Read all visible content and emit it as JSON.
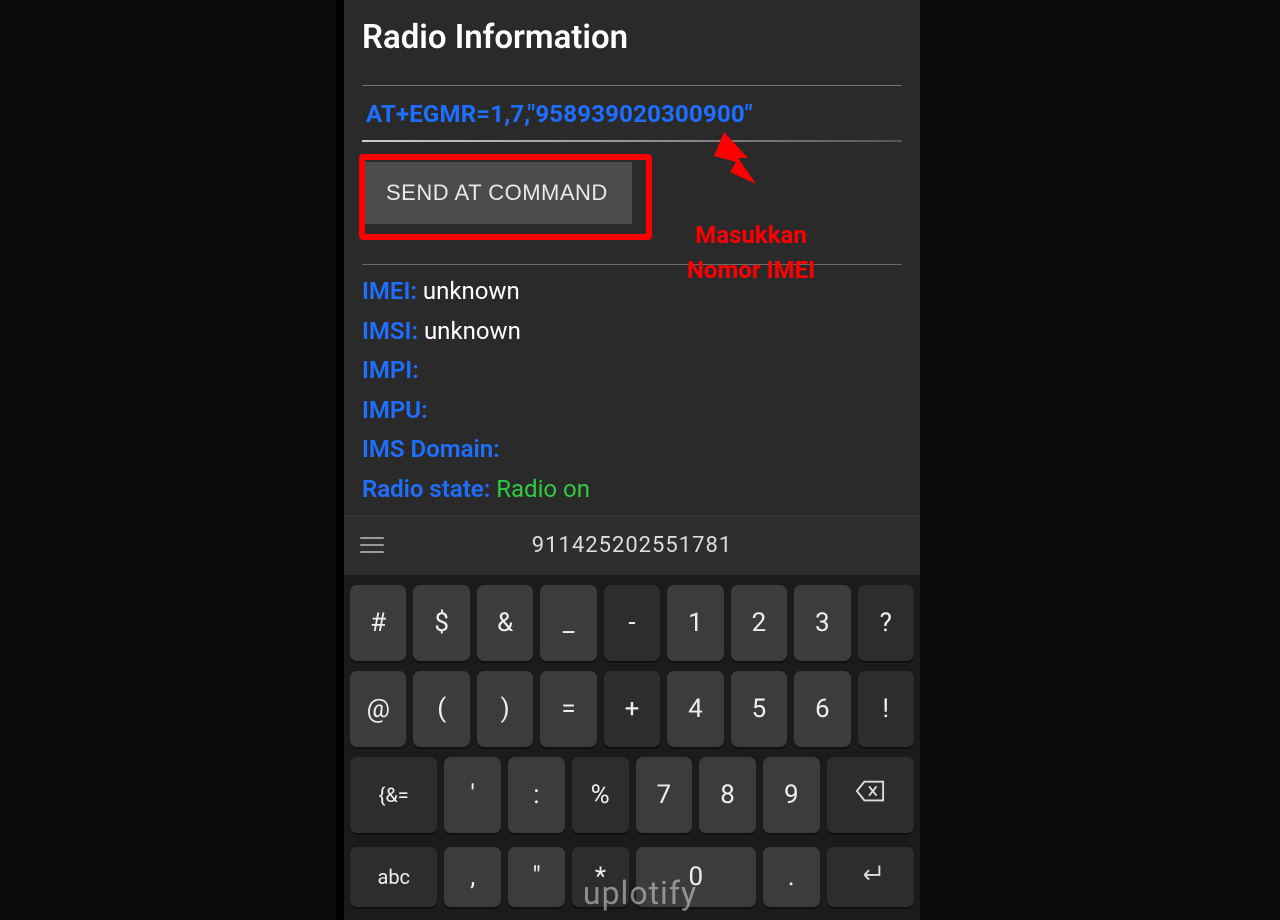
{
  "title": "Radio Information",
  "cmd_input": "AT+EGMR=1,7,\"958939020300900\"",
  "send_button": "SEND AT COMMAND",
  "hint": {
    "line1": "Masukkan",
    "line2": "Nomor IMEI"
  },
  "info": {
    "imei_label": "IMEI:",
    "imei_value": "unknown",
    "imsi_label": "IMSI:",
    "imsi_value": "unknown",
    "impi_label": "IMPI:",
    "impi_value": "",
    "impu_label": "IMPU:",
    "impu_value": "",
    "ims_label": "IMS Domain:",
    "ims_value": "",
    "radio_label": "Radio state:",
    "radio_value": "Radio on"
  },
  "keyboard_bar": "911425202551781",
  "keys": {
    "r1": [
      "#",
      "$",
      "&",
      "_",
      "-",
      "1",
      "2",
      "3",
      "?"
    ],
    "r2": [
      "@",
      "(",
      ")",
      "=",
      "+",
      "4",
      "5",
      "6",
      "!"
    ],
    "r3_left": "{&=",
    "r3_mid": [
      "'",
      ":",
      "%"
    ],
    "r3_num": [
      "7",
      "8",
      "9"
    ],
    "r4_left": "abc",
    "r4_mid": [
      ",",
      "\"",
      "*"
    ],
    "r4_num": [
      "0",
      "."
    ]
  },
  "watermark": "uplotify"
}
